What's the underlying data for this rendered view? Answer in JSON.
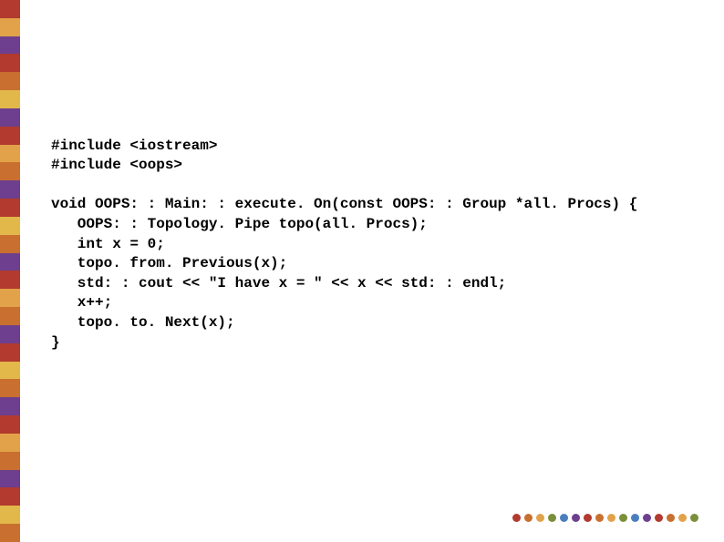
{
  "code": {
    "line1": "#include <iostream>",
    "line2": "#include <oops>",
    "blank1": "",
    "line3": "void OOPS: : Main: : execute. On(const OOPS: : Group *all. Procs) {",
    "line4": "   OOPS: : Topology. Pipe topo(all. Procs);",
    "line5": "   int x = 0;",
    "line6": "   topo. from. Previous(x);",
    "line7": "   std: : cout << \"I have x = \" << x << std: : endl;",
    "line8": "   x++;",
    "line9": "   topo. to. Next(x);",
    "line10": "}"
  },
  "stripe_colors": [
    "#b23a2e",
    "#e2a24a",
    "#6e3f8f",
    "#b23a2e",
    "#c96f2f",
    "#e2b84a",
    "#6e3f8f",
    "#b23a2e",
    "#e2a24a",
    "#c96f2f",
    "#6e3f8f",
    "#b23a2e",
    "#e2b84a",
    "#c96f2f",
    "#6e3f8f",
    "#b23a2e",
    "#e2a24a",
    "#c96f2f",
    "#6e3f8f",
    "#b23a2e",
    "#e2b84a",
    "#c96f2f",
    "#6e3f8f",
    "#b23a2e",
    "#e2a24a",
    "#c96f2f",
    "#6e3f8f",
    "#b23a2e",
    "#e2b84a",
    "#c96f2f"
  ],
  "dot_colors": [
    "#b23a2e",
    "#c96f2f",
    "#e2a24a",
    "#7a8f3a",
    "#4a7fbf",
    "#6e3f8f",
    "#b23a2e",
    "#c96f2f",
    "#e2a24a",
    "#7a8f3a",
    "#4a7fbf",
    "#6e3f8f",
    "#b23a2e",
    "#c96f2f",
    "#e2a24a",
    "#7a8f3a"
  ]
}
